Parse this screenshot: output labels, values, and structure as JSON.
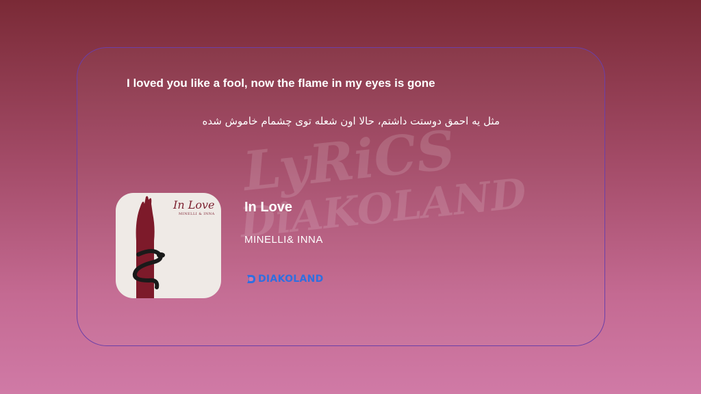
{
  "lyrics": {
    "english": "I loved you like a fool, now the flame in my eyes is gone",
    "persian": "مثل یه احمق دوستت داشتم، حالا اون شعله توی چشمام خاموش شده"
  },
  "watermark": {
    "line1": "LyRiCS",
    "line2": "DiAKOLAND"
  },
  "song": {
    "title": "In Love",
    "artist": "MINELLI& INNA"
  },
  "cover": {
    "title": "In Love",
    "artist": "MINELLI & INNA"
  },
  "logo": {
    "text": "DIAKOLAND",
    "color": "#2f6fe0"
  },
  "colors": {
    "card_border": "#6b3fa8",
    "cover_accent": "#7b1f2e"
  }
}
